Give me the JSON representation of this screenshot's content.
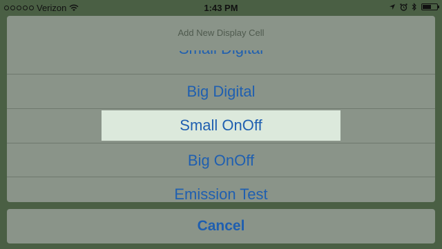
{
  "status_bar": {
    "carrier": "Verizon",
    "time": "1:43 PM",
    "signal_bars_filled": 0,
    "signal_bars_total": 5,
    "battery_level": 0.6
  },
  "sheet": {
    "title": "Add New Display Cell",
    "options": [
      {
        "label": "Small Digital",
        "partially_visible": true
      },
      {
        "label": "Big Digital"
      },
      {
        "label": "Small OnOff",
        "selected": true
      },
      {
        "label": "Big OnOff"
      },
      {
        "label": "Emission Test",
        "partially_visible": true
      }
    ]
  },
  "cancel": {
    "label": "Cancel"
  },
  "colors": {
    "accent": "#1f5fb0",
    "sheet_bg": "#8a9489",
    "selected_bg": "#dce9dc",
    "backdrop": "#4a5f44"
  },
  "icons": [
    "wifi-icon",
    "location-icon",
    "alarm-icon",
    "bluetooth-icon",
    "battery-icon"
  ]
}
